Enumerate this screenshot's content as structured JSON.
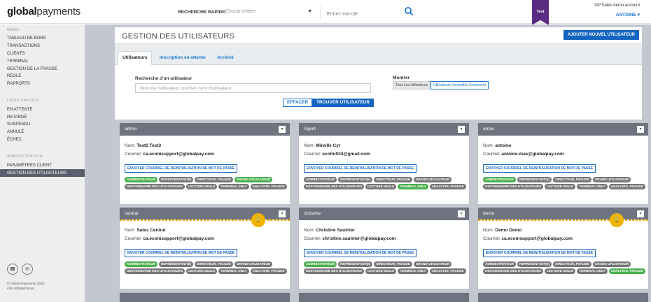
{
  "topbar": {
    "logo_bold": "global",
    "logo_light": "payments",
    "quick_label": "RECHERCHE RAPIDE:",
    "quick_select": "Choisir critère",
    "keyword_placeholder": "Entrer mot-clé",
    "env_badge": "Test",
    "account_name": "GP Sales demo account",
    "user_name": "ANTOINE"
  },
  "sidebar": {
    "menu_head": "MENU",
    "menu": [
      "TABLEAU DE BORD",
      "TRANSACTIONS",
      "CLIENTS",
      "TERMINAL",
      "GESTION DE LA FRAUDE",
      "RÈGLE",
      "RAPPORTS"
    ],
    "quick_head": "LIENS RAPIDES",
    "quick": [
      "EN ATTENTE",
      "RETARDÉ",
      "SUSPENDU",
      "ANNULÉ",
      "ÉCHEC"
    ],
    "admin_head": "ADMINISTRATION",
    "admin": [
      "PARAMÈTRES CLIENT",
      "GESTION DES UTILISATEURS"
    ],
    "copyright": "© Global Payments 2023",
    "version": "v35-7d459dc10a4"
  },
  "page": {
    "title": "GESTION DES UTILISATEURS",
    "add_button": "AJOUTER NOUVEL UTILISATEUR",
    "tabs": [
      "Utilisateurs",
      "Inscription en attente",
      "Archivé"
    ]
  },
  "search": {
    "label": "Recherche d'un utilisateur",
    "placeholder": "Nom de l'utilisateur, courriel, nom d'utilisateur",
    "show_label": "Montrer",
    "show_all": "Tous Les Utilisateurs",
    "show_locked": "Utilisateurs Verrouillés Seulement",
    "clear": "EFFACER",
    "find": "TROUVER UTILISATEUR"
  },
  "labels": {
    "nom": "Nom:",
    "courriel": "Courriel:",
    "reset": "ENVOYER COURRIEL DE RÉINITIALISATION DE MOT DE PASSE"
  },
  "roles": [
    "ADMINISTRATEUR",
    "REPRÉSENTANT(E)",
    "DIRECTEUR, FRAUDE",
    "GRAND UTILISATEUR",
    "GESTIONNAIRE DES UTILISATEURS",
    "LECTURE SEULE",
    "TERMINAL ONLY",
    "ANALYSTE, FRAUDE"
  ],
  "cards": [
    {
      "username": "admin",
      "name": "Test2 Test3",
      "email": "ca.ecomsupport@globalpay.com",
      "locked": false,
      "active_roles": [
        0,
        3
      ]
    },
    {
      "username": "Agent",
      "name": "Mireille Cyr",
      "email": "ecotm034@gmail.com",
      "locked": false,
      "active_roles": [
        6
      ]
    },
    {
      "username": "amas",
      "name": "antoine",
      "email": "antoine.mas@globalpay.com",
      "locked": false,
      "active_roles": [
        0
      ]
    },
    {
      "username": "central",
      "name": "Sales Central",
      "email": "ca.ecomsupport@globalpay.com",
      "locked": true,
      "active_roles": [
        0
      ]
    },
    {
      "username": "christine",
      "name": "Christine Saulnier",
      "email": "christine.saulnier@globalpay.com",
      "locked": false,
      "active_roles": [
        0
      ]
    },
    {
      "username": "demo",
      "name": "Demo Demo",
      "email": "ca.ecomsupport@globalpay.com",
      "locked": true,
      "active_roles": [
        7
      ]
    }
  ],
  "colors": {
    "brand_blue": "#1565c0",
    "active_role": "#4caf50",
    "inactive_role": "#777777",
    "lock": "#f0b400",
    "ribbon": "#5a2d82"
  }
}
